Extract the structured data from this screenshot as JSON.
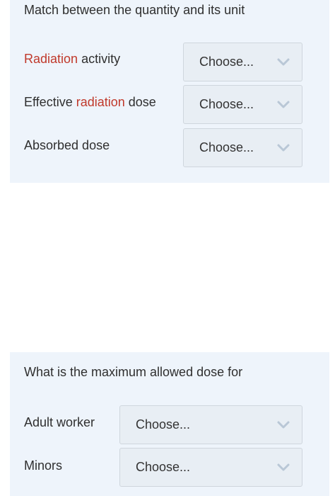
{
  "section1": {
    "heading": "Match between the quantity and its unit",
    "rows": [
      {
        "label_accent": "Radiation",
        "label_suffix": " activity",
        "select_value": "Choose..."
      },
      {
        "label_prefix": "Effective ",
        "label_accent": "radiation",
        "label_suffix": " dose",
        "select_value": "Choose..."
      },
      {
        "label": "Absorbed dose",
        "select_value": "Choose..."
      }
    ]
  },
  "section2": {
    "heading": "What is the maximum allowed dose for",
    "rows": [
      {
        "label": "Adult worker",
        "select_value": "Choose..."
      },
      {
        "label": "Minors",
        "select_value": "Choose..."
      }
    ]
  },
  "colors": {
    "accent": "#c0392b",
    "panel_bg": "#eef4fb",
    "select_bg": "#e8eef4",
    "chevron": "#b9c7d6"
  },
  "icons": {
    "dropdown": "chevron-down-icon"
  }
}
